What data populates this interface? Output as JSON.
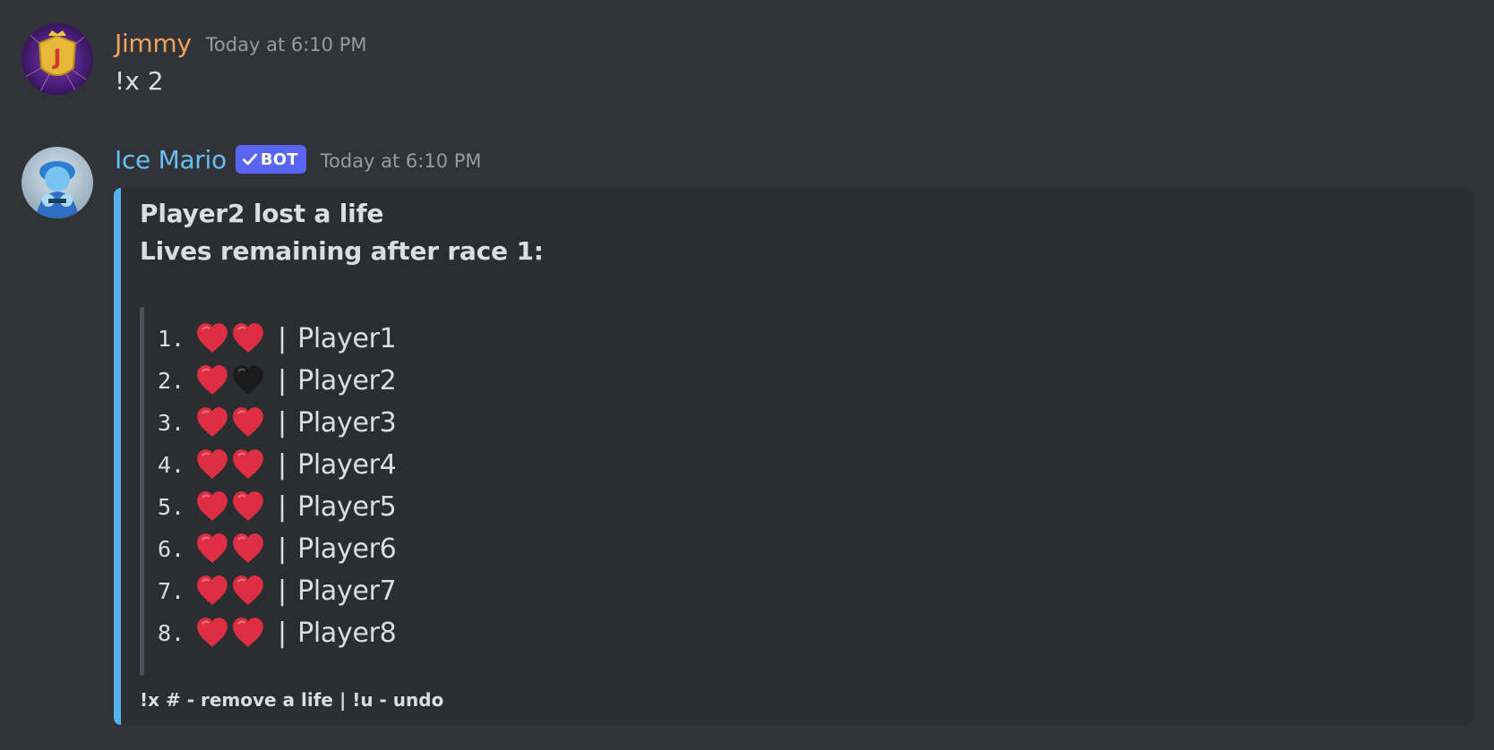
{
  "messages": [
    {
      "username": "Jimmy",
      "timestamp": "Today at 6:10 PM",
      "content": "!x 2",
      "name_color": "#f0a35c"
    },
    {
      "username": "Ice Mario",
      "bot_tag": "BOT",
      "timestamp": "Today at 6:10 PM",
      "name_color": "#66c1f2",
      "embed": {
        "accent_color": "#54b1ec",
        "line1": "Player2 lost a life",
        "line2": "Lives remaining after race 1:",
        "rows": [
          {
            "num": "1.",
            "hearts": [
              "red-heart",
              "red-heart"
            ],
            "sep": "|",
            "name": "Player1"
          },
          {
            "num": "2.",
            "hearts": [
              "red-heart",
              "black-heart"
            ],
            "sep": "|",
            "name": "Player2"
          },
          {
            "num": "3.",
            "hearts": [
              "red-heart",
              "red-heart"
            ],
            "sep": "|",
            "name": "Player3"
          },
          {
            "num": "4.",
            "hearts": [
              "red-heart",
              "red-heart"
            ],
            "sep": "|",
            "name": "Player4"
          },
          {
            "num": "5.",
            "hearts": [
              "red-heart",
              "red-heart"
            ],
            "sep": "|",
            "name": "Player5"
          },
          {
            "num": "6.",
            "hearts": [
              "red-heart",
              "red-heart"
            ],
            "sep": "|",
            "name": "Player6"
          },
          {
            "num": "7.",
            "hearts": [
              "red-heart",
              "red-heart"
            ],
            "sep": "|",
            "name": "Player7"
          },
          {
            "num": "8.",
            "hearts": [
              "red-heart",
              "red-heart"
            ],
            "sep": "|",
            "name": "Player8"
          }
        ],
        "footer": "!x # - remove a life | !u - undo"
      }
    }
  ]
}
